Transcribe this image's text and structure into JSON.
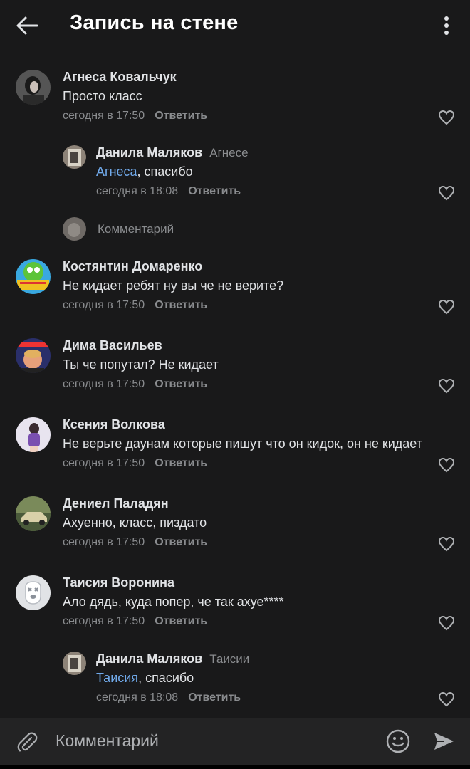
{
  "header": {
    "title": "Запись на стене"
  },
  "comments": [
    {
      "name": "Агнеса Ковальчук",
      "to": "",
      "mention": "",
      "text": "Просто класс",
      "time": "сегодня в 17:50",
      "answer": "Ответить"
    },
    {
      "name": "Данила Маляков",
      "to": "Агнесе",
      "mention": "Агнеса",
      "text": ", спасибо",
      "time": "сегодня в 18:08",
      "answer": "Ответить"
    },
    {
      "name": "Костянтин Домаренко",
      "to": "",
      "mention": "",
      "text": "Не кидает ребят ну вы че не верите?",
      "time": "сегодня в 17:50",
      "answer": "Ответить"
    },
    {
      "name": "Дима Васильев",
      "to": "",
      "mention": "",
      "text": "Ты че попутал? Не кидает",
      "time": "сегодня в 17:50",
      "answer": "Ответить"
    },
    {
      "name": "Ксения Волкова",
      "to": "",
      "mention": "",
      "text": "Не верьте даунам которые пишут что он кидок, он не кидает",
      "time": "сегодня в 17:50",
      "answer": "Ответить"
    },
    {
      "name": "Дениел Паладян",
      "to": "",
      "mention": "",
      "text": "Ахуенно, класс, пиздато",
      "time": "сегодня в 17:50",
      "answer": "Ответить"
    },
    {
      "name": "Таисия Воронина",
      "to": "",
      "mention": "",
      "text": "Ало дядь, куда попер, че так ахуе****",
      "time": "сегодня в 17:50",
      "answer": "Ответить"
    },
    {
      "name": "Данила Маляков",
      "to": "Таисии",
      "mention": "Таисия",
      "text": ", спасибо",
      "time": "сегодня в 18:08",
      "answer": "Ответить"
    }
  ],
  "reply_stub": {
    "placeholder": "Комментарий"
  },
  "composer": {
    "placeholder": "Комментарий"
  },
  "icons": {
    "back": "arrow-left-icon",
    "more": "more-vertical-icon",
    "like": "heart-icon",
    "attach": "paperclip-icon",
    "emoji": "smile-icon",
    "send": "send-icon"
  },
  "colors": {
    "background": "#19191a",
    "link": "#71aaeb",
    "secondary_text": "#8a8c8f",
    "composer": "#232324"
  }
}
